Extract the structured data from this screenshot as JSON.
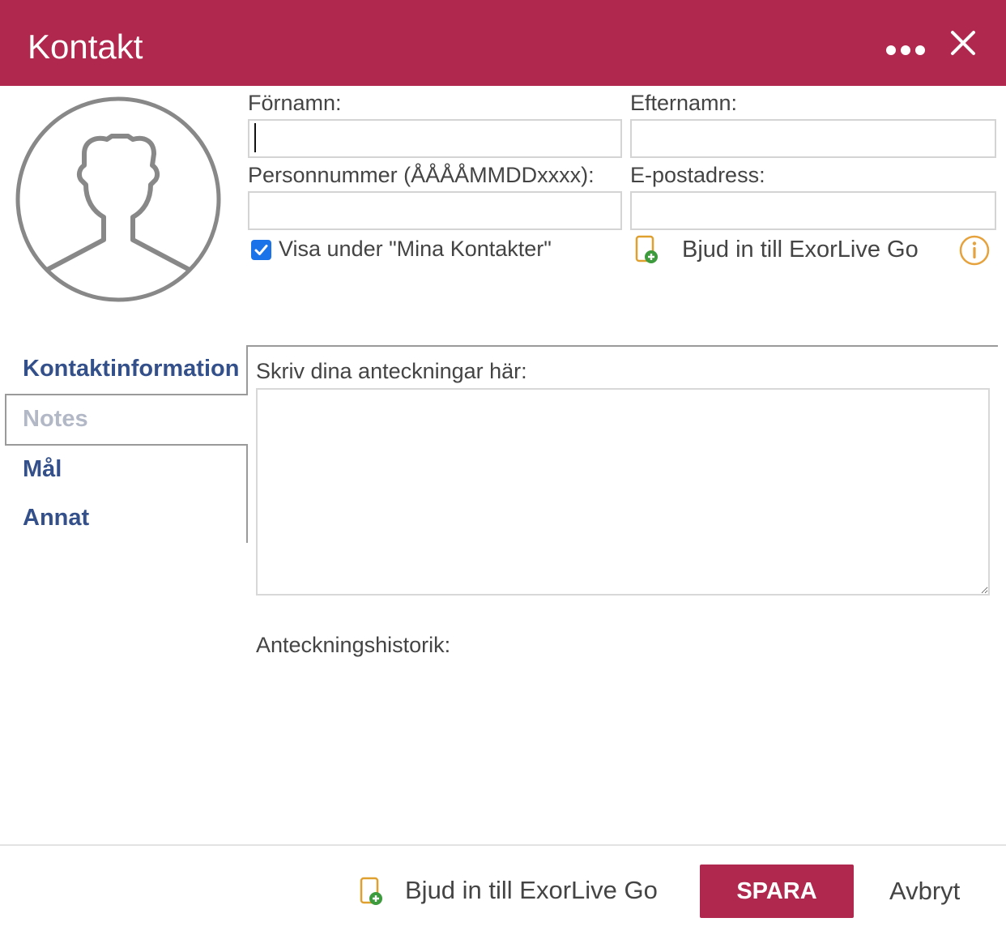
{
  "dialog": {
    "title": "Kontakt",
    "accent_color": "#b1284e",
    "header_icons": [
      "more-horizontal-icon",
      "close-icon"
    ]
  },
  "form": {
    "first_name": {
      "label": "Förnamn:",
      "value": ""
    },
    "last_name": {
      "label": "Efternamn:",
      "value": ""
    },
    "personal_number": {
      "label": "Personnummer (ÅÅÅÅMMDDxxxx):",
      "value": ""
    },
    "email": {
      "label": "E-postadress:",
      "value": ""
    },
    "show_in_contacts": {
      "label": "Visa under \"Mina Kontakter\"",
      "checked": true
    },
    "invite": {
      "label": "Bjud in till ExorLive Go",
      "icon": "phone-add-icon"
    }
  },
  "tabs": [
    {
      "label": "Kontaktinformation",
      "active": false
    },
    {
      "label": "Notes",
      "active": true
    },
    {
      "label": "Mål",
      "active": false
    },
    {
      "label": "Annat",
      "active": false
    }
  ],
  "notes": {
    "prompt": "Skriv dina anteckningar här:",
    "value": "",
    "history_label": "Anteckningshistorik:"
  },
  "footer": {
    "invite_label": "Bjud in till ExorLive Go",
    "save_label": "SPARA",
    "cancel_label": "Avbryt"
  }
}
